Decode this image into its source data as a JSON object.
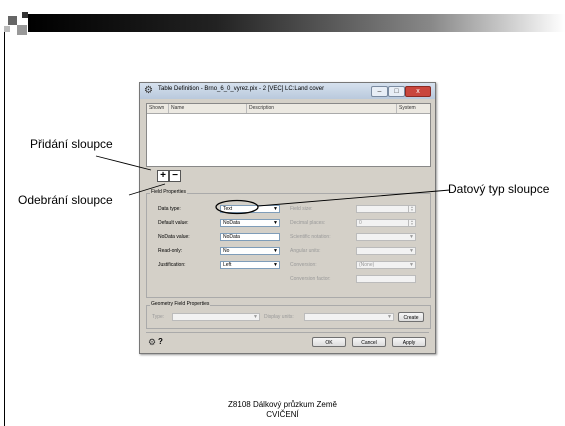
{
  "slide": {
    "callouts": {
      "add_column": "Přidání sloupce",
      "remove_column": "Odebrání sloupce",
      "data_type": "Datový typ sloupce"
    },
    "footer": {
      "line1": "Z8108 Dálkový průzkum Země",
      "line2": "CVIČENÍ"
    }
  },
  "window": {
    "title": "Table Definition - Brno_6_0_vyrez.pix - 2 [VEC] LC:Land cover",
    "icon": "gear-icon",
    "controls": {
      "minimize": "–",
      "maximize": "□",
      "close": "x"
    },
    "list_columns": [
      "Shown",
      "Name",
      "Description",
      "System"
    ],
    "add_button": "+",
    "remove_button": "−",
    "field_properties": {
      "title": "Field Properties",
      "rows": [
        {
          "label": "Data type:",
          "value": "Text"
        },
        {
          "label": "Default value:",
          "value": "NoData"
        },
        {
          "label": "NoData value:",
          "value": "NoData"
        },
        {
          "label": "Read-only:",
          "value": "No"
        },
        {
          "label": "Justification:",
          "value": "Left"
        }
      ],
      "right_rows": [
        {
          "label": "Field size:",
          "value": ""
        },
        {
          "label": "Decimal places:",
          "value": "0"
        },
        {
          "label": "Scientific notation:",
          "value": ""
        },
        {
          "label": "Angular units:",
          "value": ""
        },
        {
          "label": "Conversion:",
          "value": "(None)"
        },
        {
          "label": "Conversion factor:",
          "value": ""
        }
      ]
    },
    "geometry": {
      "title": "Geometry Field Properties",
      "type_label": "Type:",
      "display_units_label": "Display units:",
      "create_button": "Create"
    },
    "help_icon_label": "?",
    "buttons": {
      "ok": "OK",
      "cancel": "Cancel",
      "apply": "Apply"
    }
  }
}
